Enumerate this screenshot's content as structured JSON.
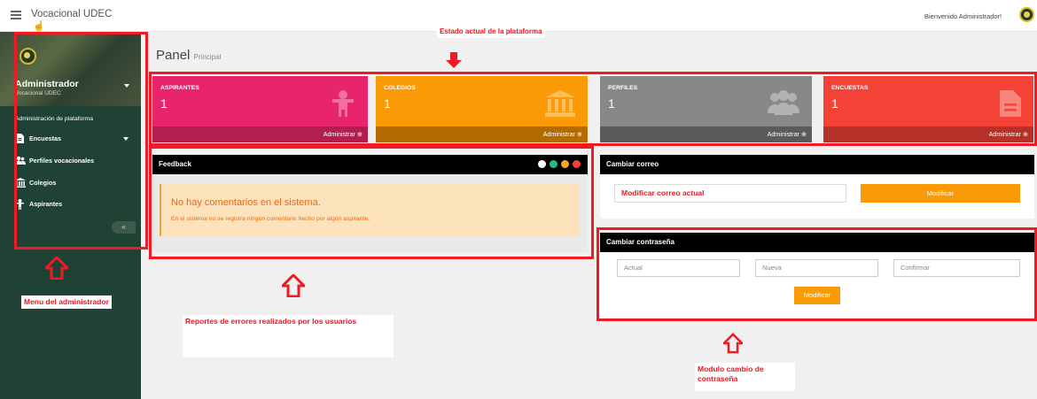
{
  "header": {
    "title": "Vocacional UDEC",
    "welcome": "Bienvenido Administrador!"
  },
  "sidebar": {
    "admin_name": "Administrador",
    "admin_sub": "Vocacional UDEC",
    "menu_title": "Administración de plataforma",
    "items": [
      {
        "label": "Encuestas",
        "icon": "document-icon"
      },
      {
        "label": "Perfiles vocacionales",
        "icon": "users-icon"
      },
      {
        "label": "Colegios",
        "icon": "bank-icon"
      },
      {
        "label": "Aspirantes",
        "icon": "person-icon"
      }
    ],
    "collapse": "«"
  },
  "panel": {
    "title": "Panel",
    "subtitle": "Principal"
  },
  "cards": [
    {
      "label": "ASPIRANTES",
      "value": "1",
      "footer": "Administrar",
      "color": "#e8256a",
      "foot_color": "#b01e52",
      "icon": "child-icon"
    },
    {
      "label": "COLEGIOS",
      "value": "1",
      "footer": "Administrar",
      "color": "#fb9a07",
      "foot_color": "#b36b00",
      "icon": "bank-icon"
    },
    {
      "label": "PERFILES",
      "value": "1",
      "footer": "Administrar",
      "color": "#888888",
      "foot_color": "#5a5a5a",
      "icon": "users-icon"
    },
    {
      "label": "ENCUESTAS",
      "value": "1",
      "footer": "Administrar",
      "color": "#f44336",
      "foot_color": "#b53027",
      "icon": "document-icon"
    }
  ],
  "feedback": {
    "title": "Feedback",
    "alert_title": "No hay comentarios en el sistema.",
    "alert_text": "En el sistema no se registra ningún comentario hecho por algún aspirante."
  },
  "email": {
    "title": "Cambiar correo",
    "input": "Modificar correo actual",
    "button": "Modificar"
  },
  "password": {
    "title": "Cambiar contraseña",
    "placeholders": {
      "current": "Actual",
      "new": "Nueva",
      "confirm": "Confirmar"
    },
    "button": "Modificar"
  },
  "annotations": {
    "platform_state": "Estado actual de la plataforma",
    "admin_menu": "Menu del administrador",
    "error_reports": "Reportes de errores realizados por los usuarios",
    "password_module": "Modulo cambio de contraseña"
  },
  "colors": {
    "sidebar": "#1f4234",
    "accent": "#fb9a07",
    "annotation": "#ee1a24"
  }
}
